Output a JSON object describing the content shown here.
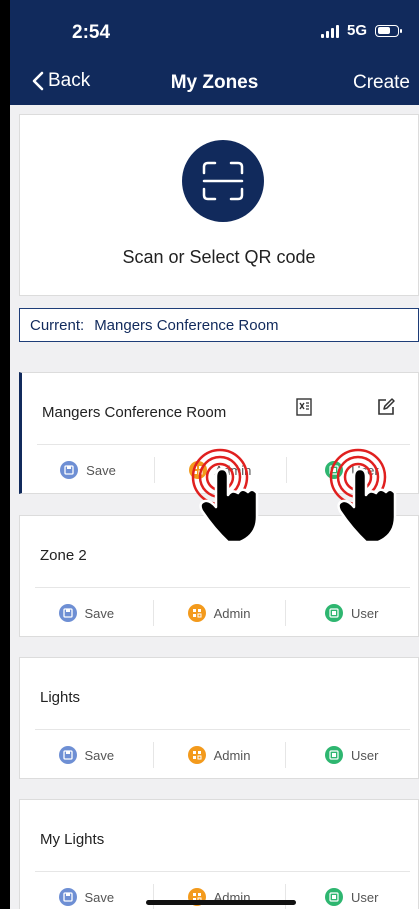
{
  "status": {
    "time": "2:54",
    "network": "5G"
  },
  "nav": {
    "back": "Back",
    "title": "My Zones",
    "create": "Create"
  },
  "scan": {
    "label": "Scan or Select QR code"
  },
  "current": {
    "label": "Current:",
    "value": "Mangers Conference Room"
  },
  "actions": {
    "save": "Save",
    "admin": "Admin",
    "user": "User"
  },
  "zones": [
    {
      "name": "Mangers Conference Room",
      "active": true
    },
    {
      "name": "Zone 2",
      "active": false
    },
    {
      "name": "Lights",
      "active": false
    },
    {
      "name": "My Lights",
      "active": false
    }
  ],
  "colors": {
    "header": "#112a5c",
    "save": "#6e8fd4",
    "admin": "#f39a1c",
    "user": "#2eb670",
    "tap_ring": "#e0201f"
  }
}
